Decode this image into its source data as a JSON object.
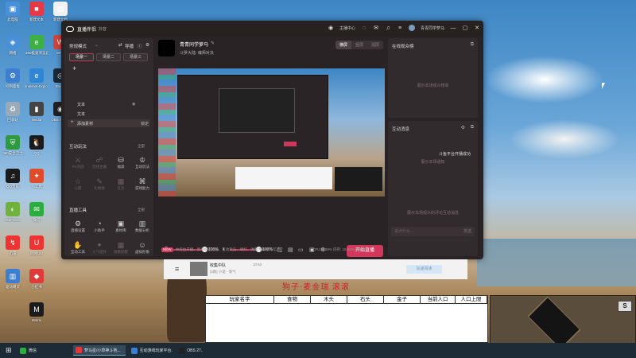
{
  "desktop": {
    "icons": [
      {
        "label": "此电脑",
        "color": "#4a90d9",
        "glyph": "▣"
      },
      {
        "label": "新建文本",
        "color": "#e63946",
        "glyph": "■"
      },
      {
        "label": "新建文档",
        "color": "#f1f1f1",
        "glyph": "▤"
      },
      {
        "label": "网络",
        "color": "#4a90d9",
        "glyph": "◈"
      },
      {
        "label": "360极速浏览器",
        "color": "#3cb043",
        "glyph": "e"
      },
      {
        "label": "WPS",
        "color": "#d6443c",
        "glyph": "W"
      },
      {
        "label": "控制面板",
        "color": "#3c7fd1",
        "glyph": "⚙"
      },
      {
        "label": "Internet Explorer",
        "color": "#2f85d6",
        "glyph": "e"
      },
      {
        "label": "Steam",
        "color": "#1b2838",
        "glyph": "◎"
      },
      {
        "label": "回收站",
        "color": "#9ab",
        "glyph": "♻"
      },
      {
        "label": "Nvidia",
        "color": "#444",
        "glyph": "▮"
      },
      {
        "label": "OBS Studio",
        "color": "#222",
        "glyph": "◉"
      },
      {
        "label": "360安全卫士",
        "color": "#2e9a3e",
        "glyph": "⛨"
      },
      {
        "label": "QQ",
        "color": "#1b1b1b",
        "glyph": "🐧"
      },
      {
        "label": "QQ音乐",
        "color": "#1b1b1b",
        "glyph": "♫"
      },
      {
        "label": "小工具",
        "color": "#e04b2a",
        "glyph": "✦"
      },
      {
        "label": "GeForce",
        "color": "#6fb23d",
        "glyph": "◐"
      },
      {
        "label": "微信",
        "color": "#2aae3d",
        "glyph": "✉"
      },
      {
        "label": "迅雷",
        "color": "#e33",
        "glyph": "↯"
      },
      {
        "label": "网易UU",
        "color": "#e33",
        "glyph": "U"
      },
      {
        "label": "驱动精灵",
        "color": "#3c7fd1",
        "glyph": "▥"
      },
      {
        "label": "小红书",
        "color": "#e03a3a",
        "glyph": "◆"
      },
      {
        "label": "Motrix",
        "color": "#1b1b1b",
        "glyph": "M"
      }
    ]
  },
  "app": {
    "title": "直播伴侣",
    "subtitle": "抖音",
    "header_chip": "主播中心",
    "user_name": "青青同学萝马",
    "left": {
      "mode_label": "常规模式",
      "guide_label": "导播",
      "scenes": [
        "场景一",
        "场景二",
        "场景三"
      ],
      "sources": [
        {
          "label": "文本"
        },
        {
          "label": "文本"
        }
      ],
      "add_material": "添加素材",
      "lock": "锁定",
      "interactive_title": "互动玩法",
      "interactive_more": "全部",
      "interactive_items": [
        {
          "label": "PK对战",
          "glyph": "⚔",
          "dim": true
        },
        {
          "label": "连线主播",
          "glyph": "☍",
          "dim": true
        },
        {
          "label": "福袋",
          "glyph": "⛁",
          "dim": false
        },
        {
          "label": "互动玩法",
          "glyph": "♔",
          "dim": false
        },
        {
          "label": "心愿",
          "glyph": "☆",
          "dim": true
        },
        {
          "label": "礼物榜",
          "glyph": "✎",
          "dim": true
        },
        {
          "label": "红包",
          "glyph": "▦",
          "dim": true
        },
        {
          "label": "游戏能力",
          "glyph": "⌘",
          "dim": false
        }
      ],
      "tools_title": "直播工具",
      "tools_more": "全部",
      "tools_items": [
        {
          "label": "直播设置",
          "glyph": "⚙",
          "dim": false
        },
        {
          "label": "小助手",
          "glyph": "◔",
          "dim": false
        },
        {
          "label": "素材库",
          "glyph": "▣",
          "dim": false
        },
        {
          "label": "数据分析",
          "glyph": "▥",
          "dim": false
        },
        {
          "label": "互动工具",
          "glyph": "✋",
          "dim": false
        },
        {
          "label": "人气提升",
          "glyph": "✦",
          "dim": true
        },
        {
          "label": "观看提醒",
          "glyph": "▦",
          "dim": true
        },
        {
          "label": "虚拟形象",
          "glyph": "☺",
          "dim": false
        }
      ]
    },
    "center": {
      "streamer_name": "青青同学萝马",
      "category": "斗罗大陆: 魂师对决",
      "quality_options": [
        "横屏",
        "竖屏",
        "混屏"
      ],
      "mic_volume": "100%",
      "desk_volume": "100%",
      "go_live_label": "开始直播",
      "status_badge": "NEW",
      "status_line": "中控台开播、新增解锁功能、互动玩法、填好、弹幕弹幕/发布信息",
      "stats": "CPU: 0.69%  内存: 15.94%  帧率:30"
    },
    "right": {
      "audience_title": "在线观众榜",
      "audience_empty": "展示本场观众榜单",
      "messages_title": "互动消息",
      "messages_notice": "斗鱼平台开播成功",
      "messages_empty": "展示本场通知",
      "comments_empty": "展示本场观众的评论互动消息",
      "chat_placeholder": "说点什么...",
      "send_label": "发送"
    }
  },
  "notice": {
    "title": "收集中队",
    "subtitle": "[3款] 小说 · 等气",
    "time": "10:52",
    "button": "加速阅读"
  },
  "banner": "狗子·麦金瑞 滚滚",
  "game_table": {
    "headers": [
      "玩家名字",
      "食物",
      "木头",
      "石头",
      "金子",
      "当前人口",
      "人口上限"
    ]
  },
  "game_panel": {
    "buttons": [
      "S",
      "?"
    ]
  },
  "taskbar": {
    "items": [
      {
        "label": "微信",
        "color": "#2aae3d",
        "active": false
      },
      {
        "label": "萝马星/小草神斗地...",
        "color": "#e33",
        "active": true
      },
      {
        "label": "互动游戏玩家平台...",
        "color": "#3c7fd1",
        "active": false
      },
      {
        "label": "OBS 27...",
        "color": "#222",
        "active": false
      }
    ]
  }
}
